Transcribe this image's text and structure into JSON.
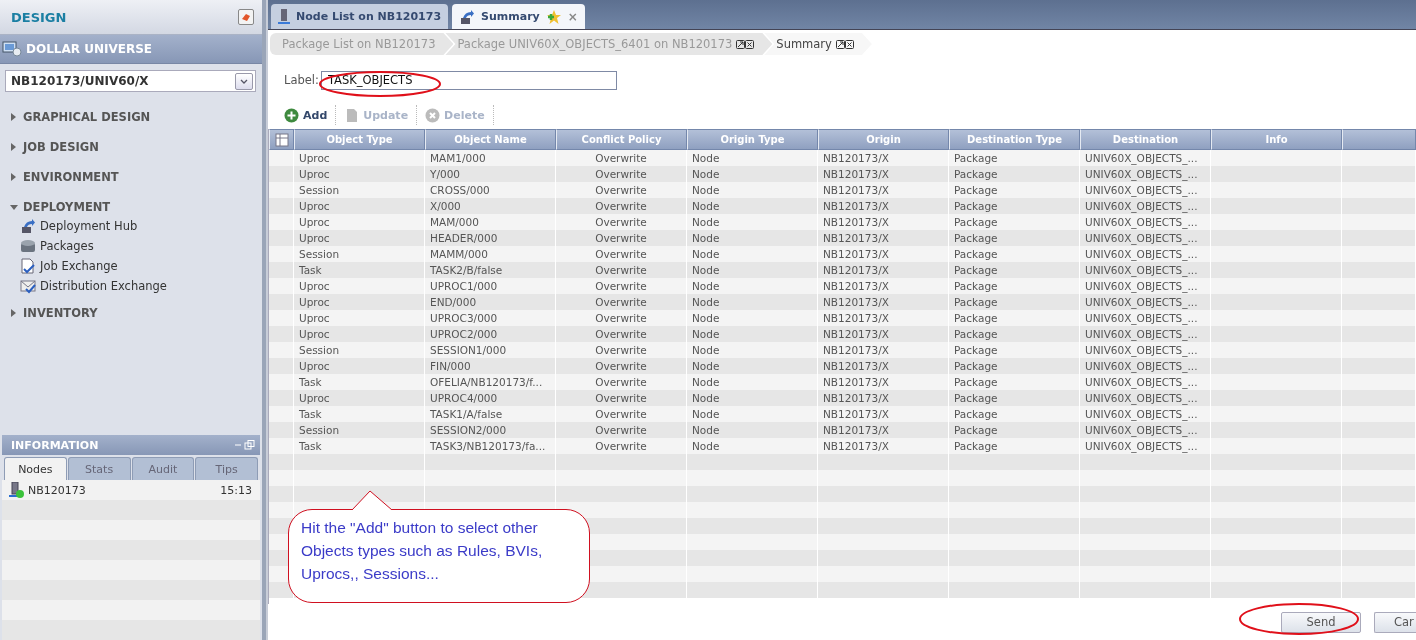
{
  "sidebar": {
    "title": "DESIGN",
    "universe": "DOLLAR UNIVERSE",
    "node_select": {
      "value": "NB120173/UNIV60/X"
    },
    "sections": [
      {
        "label": "GRAPHICAL DESIGN",
        "expanded": false
      },
      {
        "label": "JOB DESIGN",
        "expanded": false
      },
      {
        "label": "ENVIRONMENT",
        "expanded": false
      },
      {
        "label": "DEPLOYMENT",
        "expanded": true,
        "children": [
          {
            "label": "Deployment Hub"
          },
          {
            "label": "Packages"
          },
          {
            "label": "Job Exchange"
          },
          {
            "label": "Distribution Exchange"
          }
        ]
      },
      {
        "label": "INVENTORY",
        "expanded": false
      }
    ]
  },
  "info_panel": {
    "title": "INFORMATION",
    "tabs": [
      {
        "label": "Nodes",
        "selected": true
      },
      {
        "label": "Stats",
        "selected": false
      },
      {
        "label": "Audit",
        "selected": false
      },
      {
        "label": "Tips",
        "selected": false
      }
    ],
    "rows": [
      {
        "name": "NB120173",
        "time": "15:13"
      }
    ]
  },
  "tabs": [
    {
      "label": "Node List on NB120173",
      "selected": false
    },
    {
      "label": "Summary",
      "selected": true,
      "close": "×"
    }
  ],
  "breadcrumbs": [
    {
      "label": "Package List on NB120173",
      "selected": false,
      "closable": false
    },
    {
      "label": "Package UNIV60X_OBJECTS_6401 on NB120173",
      "selected": false,
      "closable": true
    },
    {
      "label": "Summary",
      "selected": true,
      "closable": true
    }
  ],
  "label_field": {
    "label": "Label:",
    "value": "TASK_OBJECTS"
  },
  "toolbar": [
    {
      "label": "Add",
      "disabled": false
    },
    {
      "label": "Update",
      "disabled": true
    },
    {
      "label": "Delete",
      "disabled": true
    }
  ],
  "table": {
    "columns": [
      "Object Type",
      "Object Name",
      "Conflict Policy",
      "Origin Type",
      "Origin",
      "Destination Type",
      "Destination",
      "Info"
    ],
    "rows": [
      [
        "Uproc",
        "MAM1/000",
        "Overwrite",
        "Node",
        "NB120173/X",
        "Package",
        "UNIV60X_OBJECTS_..."
      ],
      [
        "Uproc",
        "Y/000",
        "Overwrite",
        "Node",
        "NB120173/X",
        "Package",
        "UNIV60X_OBJECTS_..."
      ],
      [
        "Session",
        "CROSS/000",
        "Overwrite",
        "Node",
        "NB120173/X",
        "Package",
        "UNIV60X_OBJECTS_..."
      ],
      [
        "Uproc",
        "X/000",
        "Overwrite",
        "Node",
        "NB120173/X",
        "Package",
        "UNIV60X_OBJECTS_..."
      ],
      [
        "Uproc",
        "MAM/000",
        "Overwrite",
        "Node",
        "NB120173/X",
        "Package",
        "UNIV60X_OBJECTS_..."
      ],
      [
        "Uproc",
        "HEADER/000",
        "Overwrite",
        "Node",
        "NB120173/X",
        "Package",
        "UNIV60X_OBJECTS_..."
      ],
      [
        "Session",
        "MAMM/000",
        "Overwrite",
        "Node",
        "NB120173/X",
        "Package",
        "UNIV60X_OBJECTS_..."
      ],
      [
        "Task",
        "TASK2/B/false",
        "Overwrite",
        "Node",
        "NB120173/X",
        "Package",
        "UNIV60X_OBJECTS_..."
      ],
      [
        "Uproc",
        "UPROC1/000",
        "Overwrite",
        "Node",
        "NB120173/X",
        "Package",
        "UNIV60X_OBJECTS_..."
      ],
      [
        "Uproc",
        "END/000",
        "Overwrite",
        "Node",
        "NB120173/X",
        "Package",
        "UNIV60X_OBJECTS_..."
      ],
      [
        "Uproc",
        "UPROC3/000",
        "Overwrite",
        "Node",
        "NB120173/X",
        "Package",
        "UNIV60X_OBJECTS_..."
      ],
      [
        "Uproc",
        "UPROC2/000",
        "Overwrite",
        "Node",
        "NB120173/X",
        "Package",
        "UNIV60X_OBJECTS_..."
      ],
      [
        "Session",
        "SESSION1/000",
        "Overwrite",
        "Node",
        "NB120173/X",
        "Package",
        "UNIV60X_OBJECTS_..."
      ],
      [
        "Uproc",
        "FIN/000",
        "Overwrite",
        "Node",
        "NB120173/X",
        "Package",
        "UNIV60X_OBJECTS_..."
      ],
      [
        "Task",
        "OFELIA/NB120173/f...",
        "Overwrite",
        "Node",
        "NB120173/X",
        "Package",
        "UNIV60X_OBJECTS_..."
      ],
      [
        "Uproc",
        "UPROC4/000",
        "Overwrite",
        "Node",
        "NB120173/X",
        "Package",
        "UNIV60X_OBJECTS_..."
      ],
      [
        "Task",
        "TASK1/A/false",
        "Overwrite",
        "Node",
        "NB120173/X",
        "Package",
        "UNIV60X_OBJECTS_..."
      ],
      [
        "Session",
        "SESSION2/000",
        "Overwrite",
        "Node",
        "NB120173/X",
        "Package",
        "UNIV60X_OBJECTS_..."
      ],
      [
        "Task",
        "TASK3/NB120173/fa...",
        "Overwrite",
        "Node",
        "NB120173/X",
        "Package",
        "UNIV60X_OBJECTS_..."
      ]
    ]
  },
  "callout": {
    "text": "Hit the \"Add\" button to select other Objects types such as Rules, BVIs, Uprocs,, Sessions..."
  },
  "buttons": [
    {
      "label": "Send"
    },
    {
      "label": "Car"
    }
  ]
}
